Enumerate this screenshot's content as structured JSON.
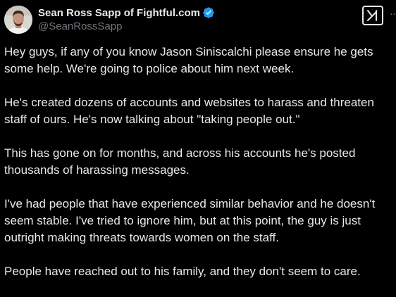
{
  "author": {
    "display_name": "Sean Ross Sapp of Fightful.com",
    "handle": "@SeanRossSapp",
    "verified": true,
    "avatar_icon": "profile-photo",
    "verified_color": "#1d9bf0"
  },
  "actions": {
    "grok_icon": "grok-icon",
    "more_icon": "more-options-icon",
    "more_label": "··"
  },
  "tweet": {
    "paragraphs": [
      "Hey guys, if any of you know Jason Siniscalchi please ensure he gets some help. We're going to police about him next week.",
      "He's created dozens of accounts and websites to harass and threaten staff of ours.  He's now talking about \"taking people out.\"",
      "This has gone on for months, and across his accounts he's posted thousands of harassing messages.",
      "I've had people that have experienced similar behavior and he doesn't seem stable. I've tried to ignore him, but at this point, the guy is just outright making threats towards women on the staff.",
      "People have reached out to his family, and they don't seem to care."
    ]
  },
  "colors": {
    "background": "#000000",
    "text": "#e7e9ea",
    "secondary_text": "#71767b"
  }
}
